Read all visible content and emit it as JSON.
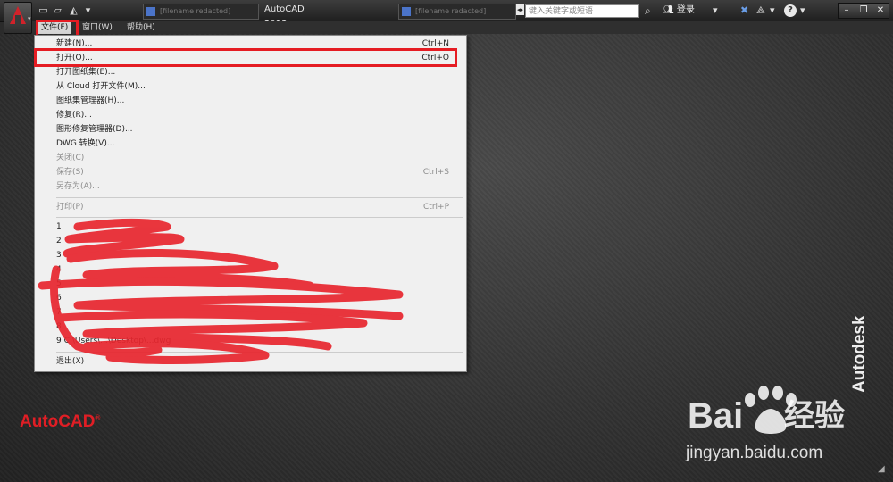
{
  "titlebar": {
    "app_title": "AutoCAD 2013",
    "doc_tabs": [
      "[filename redacted]",
      "[filename redacted]",
      "[filename redacted]"
    ],
    "search_placeholder": "键入关键字或短语",
    "login_label": "登录",
    "icons": [
      "app-menu-icon",
      "new-icon",
      "open-icon",
      "save-icon",
      "dropdown-icon",
      "search-icon",
      "user-icon",
      "exchange-icon",
      "network-icon",
      "help-icon"
    ],
    "window_buttons": [
      "–",
      "❐",
      "✕"
    ]
  },
  "menubar": {
    "items": [
      "文件(F)",
      "窗口(W)",
      "帮助(H)"
    ],
    "active": "文件(F)"
  },
  "file_menu": {
    "items": [
      {
        "label": "新建(N)...",
        "shortcut": "Ctrl+N",
        "enabled": true
      },
      {
        "label": "打开(O)...",
        "shortcut": "Ctrl+O",
        "enabled": true,
        "highlighted": true
      },
      {
        "label": "打开图纸集(E)...",
        "shortcut": "",
        "enabled": true
      },
      {
        "label": "从 Cloud 打开文件(M)...",
        "shortcut": "",
        "enabled": true
      },
      {
        "label": "图纸集管理器(H)...",
        "shortcut": "",
        "enabled": true
      },
      {
        "label": "修复(R)...",
        "shortcut": "",
        "enabled": true
      },
      {
        "label": "图形修复管理器(D)...",
        "shortcut": "",
        "enabled": true
      },
      {
        "label": "DWG 转换(V)...",
        "shortcut": "",
        "enabled": true
      },
      {
        "label": "关闭(C)",
        "shortcut": "",
        "enabled": false
      },
      {
        "label": "保存(S)",
        "shortcut": "Ctrl+S",
        "enabled": false
      },
      {
        "label": "另存为(A)...",
        "shortcut": "",
        "enabled": false
      }
    ],
    "print": {
      "label": "打印(P)",
      "shortcut": "Ctrl+P",
      "enabled": false
    },
    "recent_files": [
      "1",
      "2",
      "3",
      "4",
      "5",
      "6",
      "7",
      "8",
      "9 C:\\Users\\...\\Desktop\\...dwg"
    ],
    "exit_label": "退出(X)"
  },
  "branding": {
    "product": "AutoCAD",
    "vendor": "Autodesk",
    "watermark_text": "Bai",
    "watermark_text2": "经验",
    "watermark_url": "jingyan.baidu.com"
  },
  "colors": {
    "highlight_red": "#e51c23",
    "autocad_red": "#e01e25",
    "menu_bg": "#f0f0f0"
  }
}
